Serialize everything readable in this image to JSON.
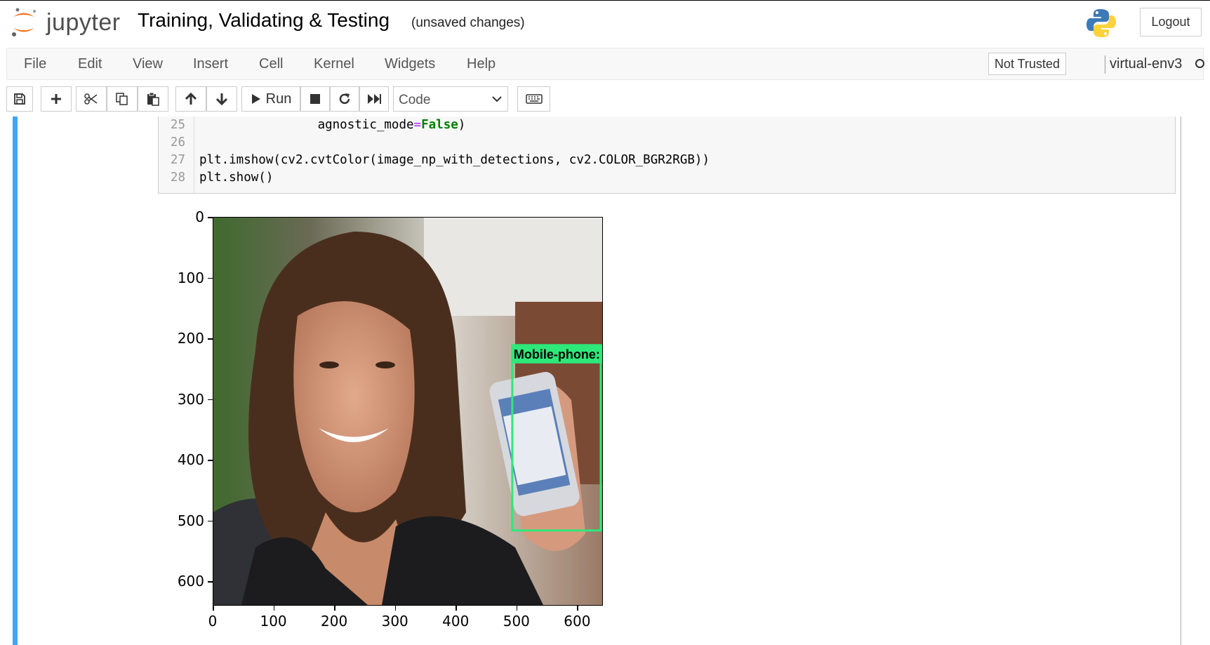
{
  "header": {
    "logo_text": "jupyter",
    "notebook_title": "Training, Validating & Testing",
    "save_status": "(unsaved changes)",
    "logout_label": "Logout"
  },
  "menubar": {
    "items": [
      "File",
      "Edit",
      "View",
      "Insert",
      "Cell",
      "Kernel",
      "Widgets",
      "Help"
    ],
    "trusted_label": "Not Trusted",
    "kernel_name": "virtual-env3"
  },
  "toolbar": {
    "run_label": "Run",
    "cell_type": "Code",
    "icons": [
      "save-icon",
      "plus-icon",
      "scissors-icon",
      "copy-icon",
      "paste-icon",
      "arrow-up-icon",
      "arrow-down-icon",
      "play-icon",
      "stop-icon",
      "restart-icon",
      "fast-forward-icon",
      "keyboard-icon"
    ]
  },
  "code_cell": {
    "lines": [
      {
        "no": "25",
        "indent": "                ",
        "before": "agnostic_mode",
        "op": "=",
        "const": "False",
        "after": ")"
      },
      {
        "no": "26",
        "text": ""
      },
      {
        "no": "27",
        "text": "plt.imshow(cv2.cvtColor(image_np_with_detections, cv2.COLOR_BGR2RGB))"
      },
      {
        "no": "28",
        "text": "plt.show()"
      }
    ]
  },
  "output": {
    "detection_label": "Mobile-phone:",
    "box_color": "#2ee87a",
    "x_ticks": [
      "0",
      "100",
      "200",
      "300",
      "400",
      "500",
      "600"
    ],
    "y_ticks": [
      "0",
      "100",
      "200",
      "300",
      "400",
      "500",
      "600"
    ],
    "image_extent": [
      0,
      640
    ],
    "detection_box": {
      "x0": 492,
      "y0": 210,
      "x1": 640,
      "y1": 515
    }
  }
}
